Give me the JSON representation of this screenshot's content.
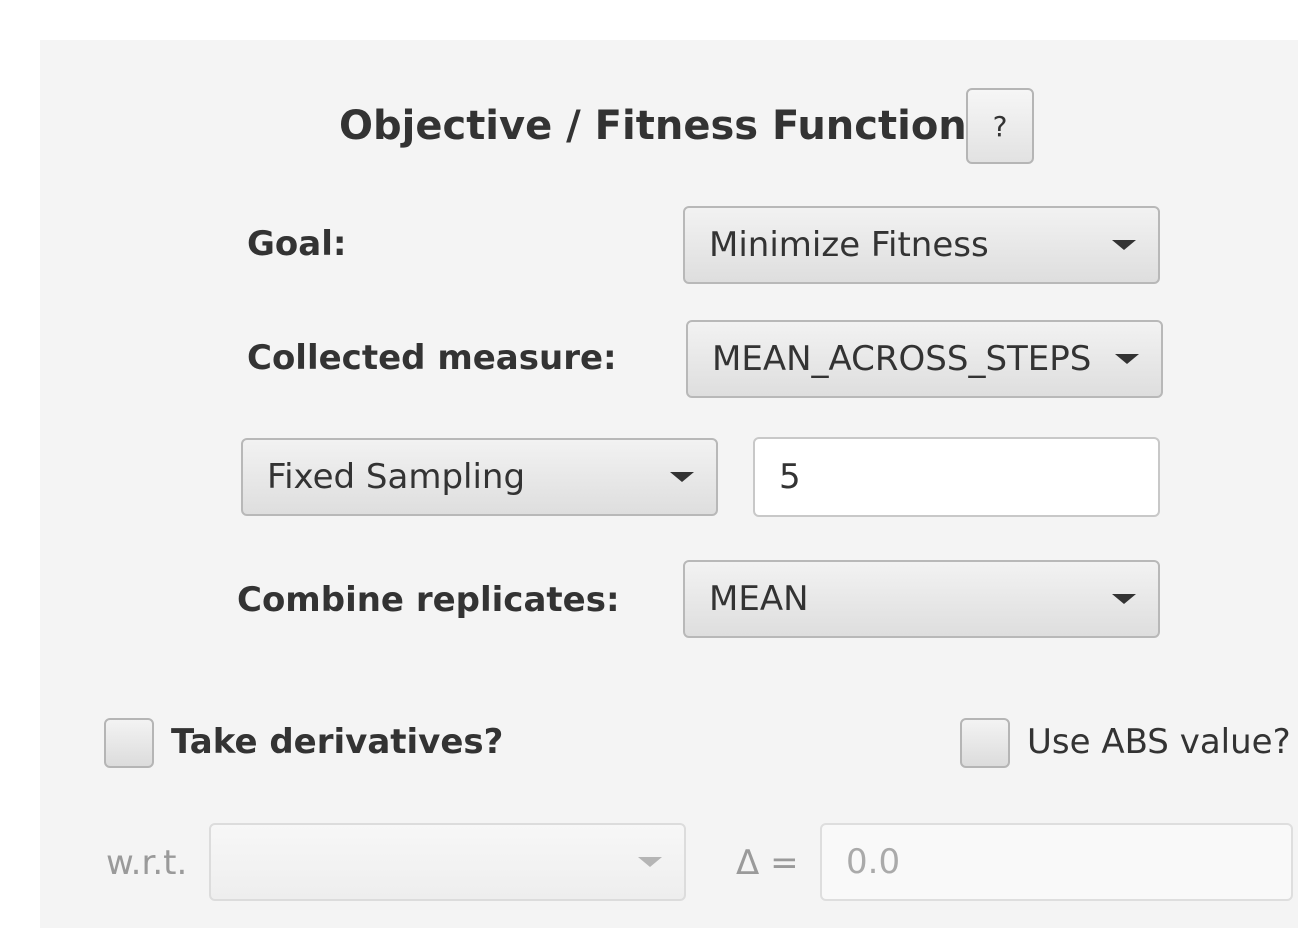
{
  "header": {
    "title": "Objective / Fitness Function",
    "help_label": "?"
  },
  "goal": {
    "label": "Goal:",
    "value": "Minimize Fitness"
  },
  "collected_measure": {
    "label": "Collected measure:",
    "value": "MEAN_ACROSS_STEPS"
  },
  "sampling": {
    "method": "Fixed Sampling",
    "count": "5"
  },
  "combine_replicates": {
    "label": "Combine replicates:",
    "value": "MEAN"
  },
  "derivatives": {
    "take_label": "Take derivatives?",
    "take_checked": false,
    "abs_label": "Use ABS value?",
    "abs_checked": false,
    "wrt_label": "w.r.t.",
    "wrt_value": "",
    "delta_label": "Δ =",
    "delta_value": "0.0"
  }
}
